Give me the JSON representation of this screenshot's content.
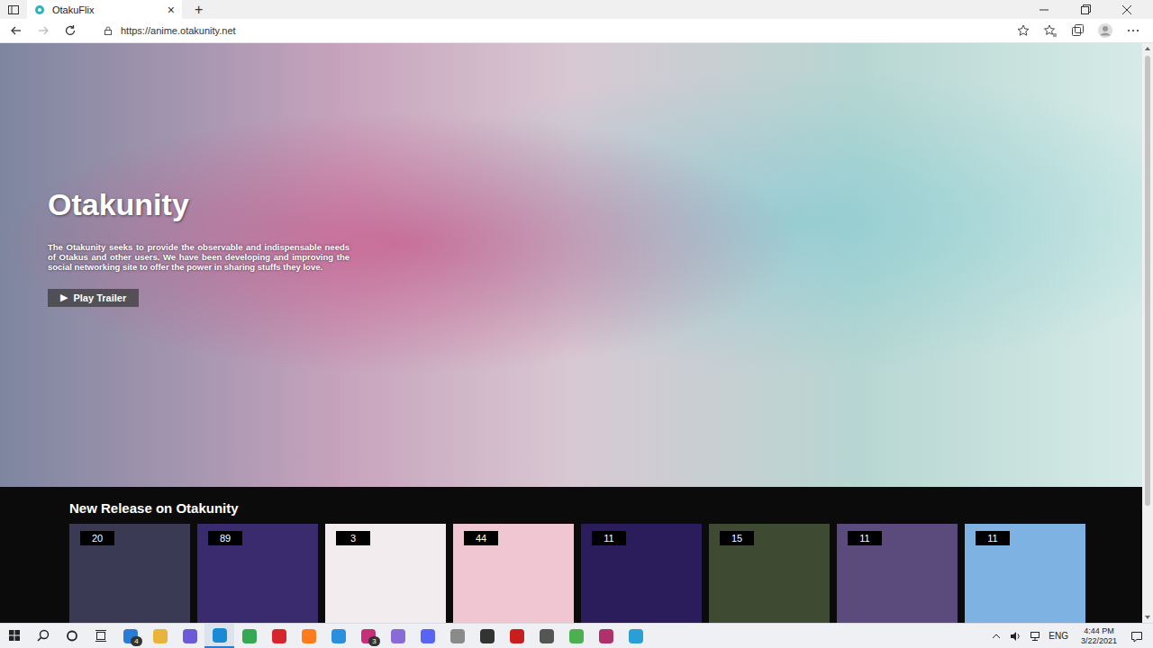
{
  "browser": {
    "tabs": [
      {
        "label": "OtakuFlix",
        "selected": true,
        "close": "×"
      }
    ],
    "new_tab": "+",
    "url": "https://anime.otakunity.net"
  },
  "hero": {
    "title": "Otakunity",
    "description": "The Otakunity seeks to provide the observable and indispensable needs of Otakus and other users. We have been developing and improving the social networking site to offer the power in sharing stuffs they love.",
    "button": "Play Trailer",
    "button_icon": "▶"
  },
  "section": {
    "title": "New Release on Otakunity",
    "cards": [
      {
        "count": "20",
        "color": "#3b3a55"
      },
      {
        "count": "89",
        "color": "#3a2a6e"
      },
      {
        "count": "3",
        "color": "#f2ecef"
      },
      {
        "count": "44",
        "color": "#f0c6d2"
      },
      {
        "count": "11",
        "color": "#2b1c5c"
      },
      {
        "count": "15",
        "color": "#3e4a32"
      },
      {
        "count": "11",
        "color": "#5b4a7c"
      },
      {
        "count": "11",
        "color": "#7db2e2"
      }
    ]
  },
  "taskbar": {
    "apps": [
      {
        "color": "#2b7cd3",
        "selected": false,
        "badge": "4"
      },
      {
        "color": "#e8b53a",
        "selected": false
      },
      {
        "color": "#6b5bd6",
        "selected": false
      },
      {
        "color": "#1a8ad4",
        "selected": true
      },
      {
        "color": "#34a853",
        "selected": false
      },
      {
        "color": "#d6262c",
        "selected": false
      },
      {
        "color": "#ff7b1c",
        "selected": false
      },
      {
        "color": "#2a8fdc",
        "selected": false
      },
      {
        "color": "#c4307a",
        "selected": false,
        "badge": "3"
      },
      {
        "color": "#8a6bd6",
        "selected": false
      },
      {
        "color": "#5865f2",
        "selected": false
      },
      {
        "color": "#8a8a8a",
        "selected": false
      },
      {
        "color": "#333333",
        "selected": false
      },
      {
        "color": "#c81e1e",
        "selected": false
      },
      {
        "color": "#555555",
        "selected": false
      },
      {
        "color": "#4caf50",
        "selected": false
      },
      {
        "color": "#b0306a",
        "selected": false
      },
      {
        "color": "#2a9fd6",
        "selected": false
      }
    ],
    "language": "ENG",
    "time": "4:44 PM",
    "date": "3/22/2021"
  }
}
